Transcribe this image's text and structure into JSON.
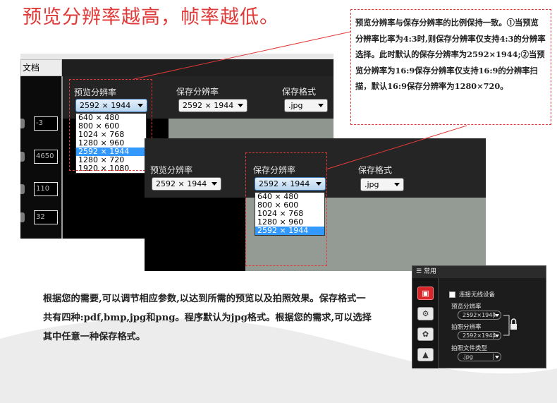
{
  "headline": "预览分辨率越高，帧率越低。",
  "callout_text": "预览分辨率与保存分辨率的比例保持一致。①当预览分辨率比率为4:3时,则保存分辨率仅支持4:3的分辨率选择。此时默认的保存分辨率为2592×1944;②当预览分辨率为16:9保存分辨率仅支持16:9的分辨率扫描，默认16:9保存分辨率为1280×720。",
  "shot1": {
    "tab_label": "文档",
    "preview_label": "预览分辨率",
    "save_label": "保存分辨率",
    "format_label": "保存格式",
    "preview_value": "2592 × 1944",
    "save_value": "2592 × 1944",
    "format_value": ".jpg",
    "preview_options": [
      "640 × 480",
      "800 × 600",
      "1024 × 768",
      "1280 × 960",
      "2592 × 1944",
      "1280 × 720",
      "1920 × 1080"
    ],
    "left_values": [
      "-3",
      "4650",
      "110",
      "32"
    ]
  },
  "shot2": {
    "preview_label": "预览分辨率",
    "save_label": "保存分辨率",
    "format_label": "保存格式",
    "preview_value": "2592 × 1944",
    "save_value": "2592 × 1944",
    "format_value": ".jpg",
    "save_options": [
      "640 × 480",
      "800 × 600",
      "1024 × 768",
      "1280 × 960",
      "2592 × 1944"
    ]
  },
  "body_text": "根据您的需要,可以调节相应参数,以达到所需的预览以及拍照效果。保存格式一共有四种:pdf,bmp,jpg和png。程序默认为jpg格式。根据您的需求,可以选择其中任意一种保存格式。",
  "panel": {
    "title": "常用",
    "wireless_label": "连接无线设备",
    "preview_label": "预览分辨率",
    "preview_value": "2592×1944",
    "photo_label": "拍照分辨率",
    "photo_value": "2592×1944",
    "filetype_label": "拍照文件类型",
    "filetype_value": ".jpg"
  },
  "colors": {
    "accent": "#e03a38",
    "selection": "#3399ff"
  }
}
